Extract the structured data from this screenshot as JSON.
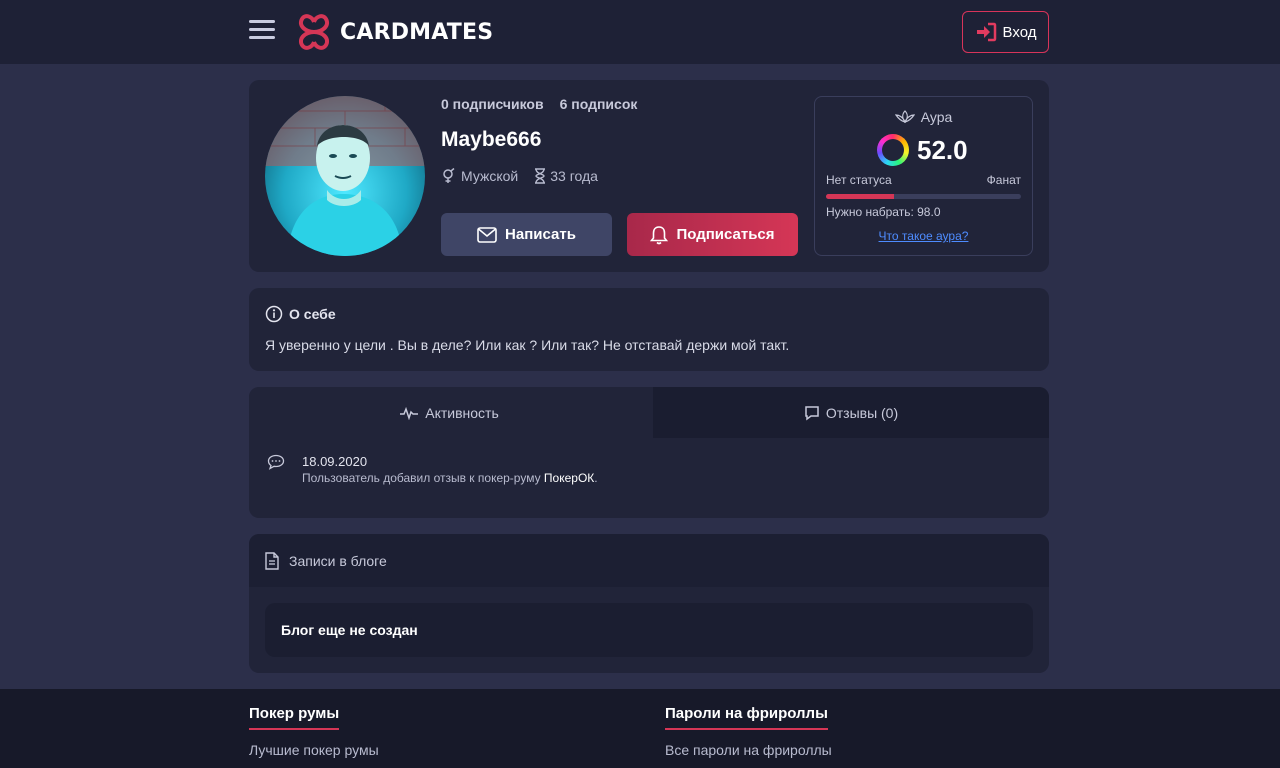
{
  "header": {
    "logo_text": "CARDMATES",
    "login_label": "Вход",
    "colors": {
      "accent": "#d53656",
      "header_bg": "#1e2136"
    }
  },
  "profile": {
    "followers": "0 подписчиков",
    "following": "6 подписок",
    "username": "Maybe666",
    "gender": "Мужской",
    "age": "33 года",
    "write_label": "Написать",
    "subscribe_label": "Подписаться"
  },
  "aura": {
    "title": "Аура",
    "value": "52.0",
    "status_left": "Нет статуса",
    "status_right": "Фанат",
    "progress_fraction": 0.35,
    "need": "Нужно набрать: 98.0",
    "link": "Что такое аура?"
  },
  "about": {
    "title": "О себе",
    "text": "Я уверенно у цели . Вы в деле? Или как ? Или так? Не отставай держи мой такт."
  },
  "activity": {
    "tabs": [
      {
        "label": "Активность",
        "icon": "pulse-icon"
      },
      {
        "label": "Отзывы (0)",
        "icon": "comment-icon"
      }
    ],
    "items": [
      {
        "date": "18.09.2020",
        "text": "Пользователь добавил отзыв к покер-руму ",
        "room": "ПокерОК",
        "suffix": "."
      }
    ]
  },
  "blog": {
    "title": "Записи в блоге",
    "empty": "Блог еще не создан"
  },
  "footer": {
    "col1": {
      "title": "Покер румы",
      "link": "Лучшие покер румы"
    },
    "col2": {
      "title": "Пароли на фрироллы",
      "link": "Все пароли на фрироллы"
    }
  }
}
